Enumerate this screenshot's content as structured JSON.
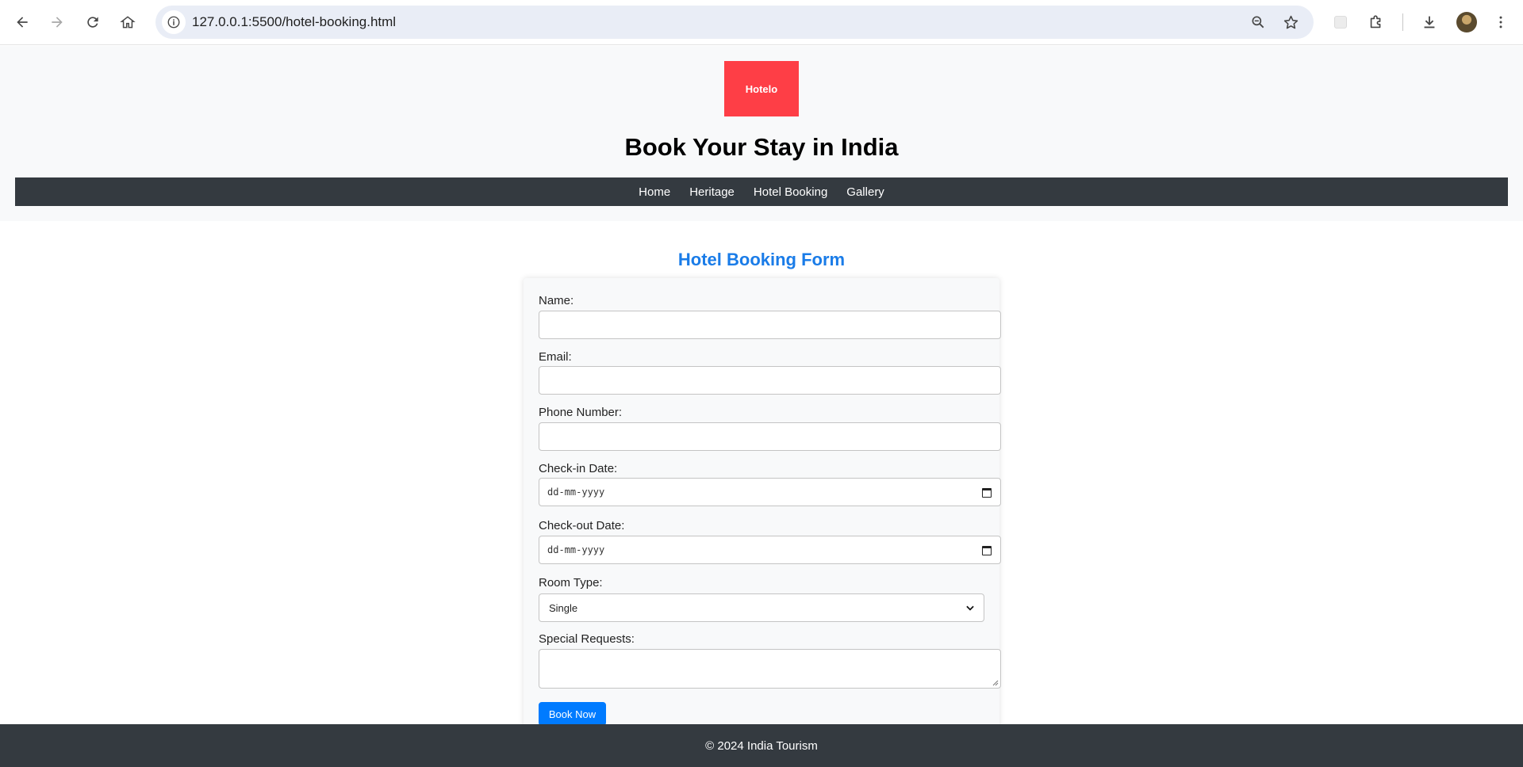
{
  "browser": {
    "url": "127.0.0.1:5500/hotel-booking.html"
  },
  "header": {
    "logo_text": "Hotelo",
    "title": "Book Your Stay in India",
    "nav": [
      "Home",
      "Heritage",
      "Hotel Booking",
      "Gallery"
    ]
  },
  "form": {
    "heading": "Hotel Booking Form",
    "name_label": "Name:",
    "email_label": "Email:",
    "phone_label": "Phone Number:",
    "checkin_label": "Check-in Date:",
    "checkin_placeholder": "dd-mm-yyyy",
    "checkout_label": "Check-out Date:",
    "checkout_placeholder": "dd-mm-yyyy",
    "room_label": "Room Type:",
    "room_selected": "Single",
    "requests_label": "Special Requests:",
    "submit_label": "Book Now"
  },
  "footer": {
    "text": "© 2024 India Tourism"
  },
  "colors": {
    "logo_bg": "#fe3e46",
    "heading": "#1a7ce8",
    "button": "#007bff",
    "dark_bar": "#343a40"
  }
}
